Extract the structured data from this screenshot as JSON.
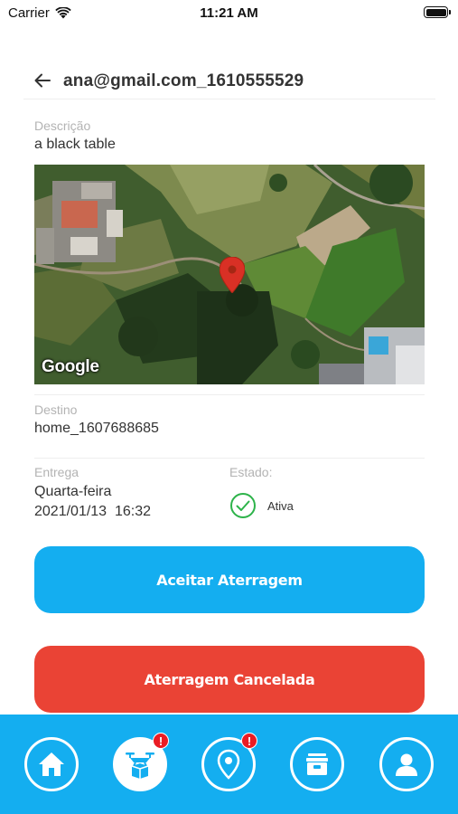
{
  "status_bar": {
    "carrier": "Carrier",
    "time": "11:21 AM"
  },
  "header": {
    "title": "ana@gmail.com_1610555529"
  },
  "description": {
    "label": "Descrição",
    "value": "a black table"
  },
  "map": {
    "provider_label": "Google",
    "pin_color": "#d93025"
  },
  "destination": {
    "label": "Destino",
    "value": "home_1607688685"
  },
  "delivery": {
    "label": "Entrega",
    "day": "Quarta-feira",
    "date": "2021/01/13  16:32"
  },
  "status": {
    "label": "Estado:",
    "value": "Ativa",
    "color": "#2db34a"
  },
  "actions": {
    "accept_label": "Aceitar Aterragem",
    "accept_color": "#14aef0",
    "cancel_label": "Aterragem Cancelada",
    "cancel_color": "#ea4335"
  },
  "tabbar": {
    "background": "#14aef0",
    "tabs": [
      {
        "icon": "home-icon"
      },
      {
        "icon": "drone-delivery-icon",
        "badge": "!"
      },
      {
        "icon": "location-pin-icon",
        "badge": "!"
      },
      {
        "icon": "package-box-icon"
      },
      {
        "icon": "user-profile-icon"
      }
    ]
  }
}
